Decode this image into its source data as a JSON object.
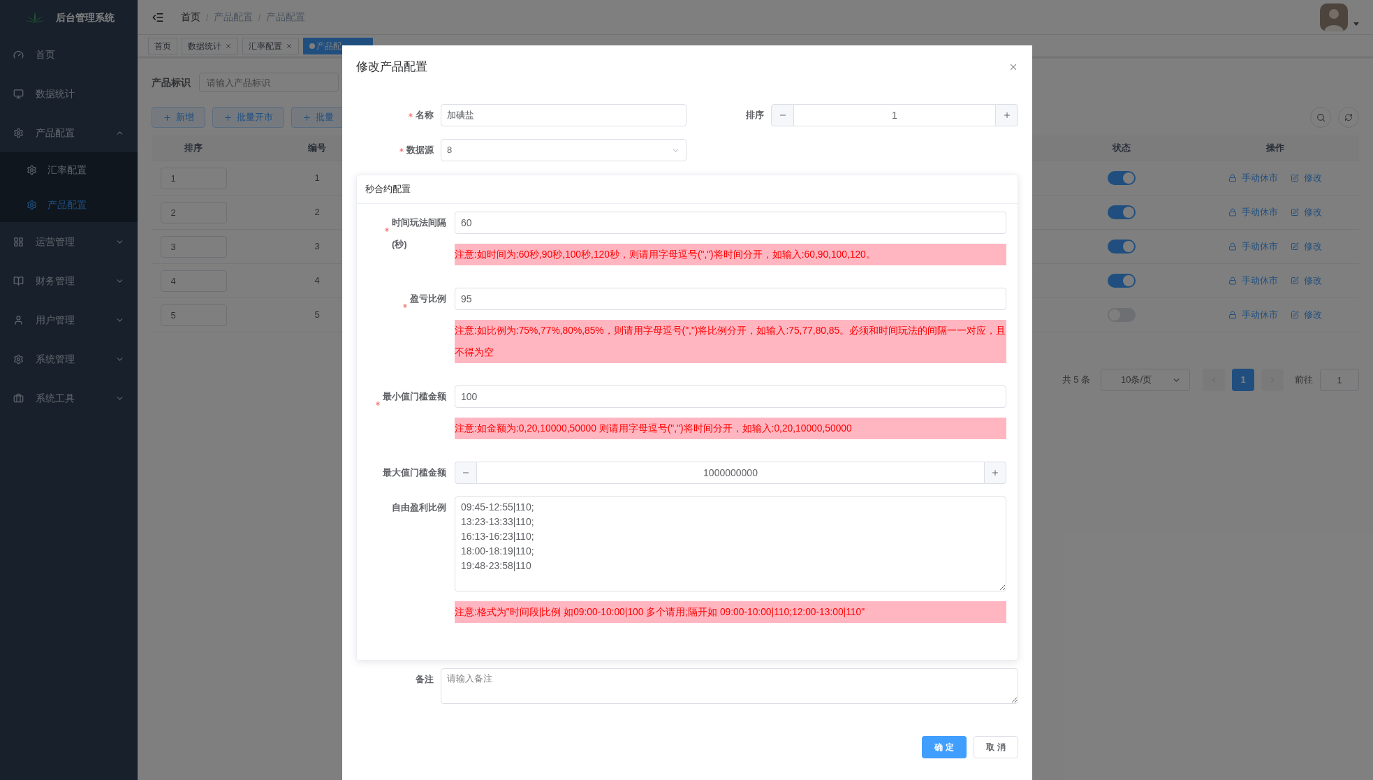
{
  "sidebar": {
    "title": "后台管理系统",
    "items": [
      {
        "label": "首页"
      },
      {
        "label": "数据统计"
      },
      {
        "label": "产品配置",
        "expanded": true,
        "children": [
          {
            "label": "汇率配置",
            "selected": false
          },
          {
            "label": "产品配置",
            "selected": true
          }
        ]
      },
      {
        "label": "运营管理",
        "expanded": false
      },
      {
        "label": "财务管理",
        "expanded": false
      },
      {
        "label": "用户管理",
        "expanded": false
      },
      {
        "label": "系统管理",
        "expanded": false
      },
      {
        "label": "系统工具",
        "expanded": false
      }
    ]
  },
  "breadcrumb": [
    "首页",
    "产品配置",
    "产品配置"
  ],
  "tabs": [
    {
      "label": "首页",
      "selected": false,
      "closable": false
    },
    {
      "label": "数据统计",
      "selected": false,
      "closable": true
    },
    {
      "label": "汇率配置",
      "selected": false,
      "closable": true
    },
    {
      "label": "产品配",
      "selected": true,
      "closable": false
    }
  ],
  "filter": {
    "label": "产品标识",
    "placeholder": "请输入产品标识"
  },
  "toolbar": [
    "新增",
    "批量开市",
    "批量"
  ],
  "table": {
    "columns": [
      "排序",
      "编号",
      "状态",
      "操作"
    ],
    "rows": [
      {
        "sort": "1",
        "number": "1",
        "on": true,
        "actions": [
          "手动休市",
          "修改"
        ]
      },
      {
        "sort": "2",
        "number": "2",
        "on": true,
        "actions": [
          "手动休市",
          "修改"
        ]
      },
      {
        "sort": "3",
        "number": "3",
        "on": true,
        "actions": [
          "手动休市",
          "修改"
        ]
      },
      {
        "sort": "4",
        "number": "4",
        "on": true,
        "actions": [
          "手动休市",
          "修改"
        ]
      },
      {
        "sort": "5",
        "number": "5",
        "on": false,
        "actions": [
          "手动休市",
          "修改"
        ]
      }
    ]
  },
  "pagination": {
    "total": "共 5 条",
    "page_size": "10条/页",
    "pages": [
      {
        "label": "1",
        "selected": true
      }
    ],
    "goto_label": "前往",
    "goto_value": "1"
  },
  "dialog": {
    "title": "修改产品配置",
    "name": {
      "label": "名称",
      "required": true,
      "value": "加碘盐"
    },
    "sort": {
      "label": "排序",
      "value": "1"
    },
    "source": {
      "label": "数据源",
      "required": true,
      "value": "8"
    },
    "section": {
      "title": "秒合约配置",
      "fields": [
        {
          "kind": "text",
          "label": "时间玩法间隔\n(秒)",
          "required": true,
          "value": "60",
          "note": "注意:如时间为:60秒,90秒,100秒,120秒，则请用字母逗号(\",\")将时间分开，如输入:60,90,100,120。"
        },
        {
          "kind": "text",
          "label": "盈亏比例",
          "required": true,
          "value": "95",
          "note": "注意:如比例为:75%,77%,80%,85%，则请用字母逗号(\",\")将比例分开，如输入:75,77,80,85。必须和时间玩法的间隔一一对应，且不得为空"
        },
        {
          "kind": "text",
          "label": "最小值门槛金额",
          "required": true,
          "value": "100",
          "note": "注意:如金额为:0,20,10000,50000 则请用字母逗号(\",\")将时间分开，如输入:0,20,10000,50000"
        },
        {
          "kind": "stepper",
          "label": "最大值门槛金额",
          "required": false,
          "value": "1000000000"
        },
        {
          "kind": "textarea",
          "label": "自由盈利比例",
          "required": false,
          "value": "09:45-12:55|110;\n13:23-13:33|110;\n16:13-16:23|110;\n18:00-18:19|110;\n19:48-23:58|110",
          "note": "注意:格式为\"时间段|比例 如09:00-10:00|100 多个请用;隔开如 09:00-10:00|110;12:00-13:00|110\""
        }
      ]
    },
    "remark": {
      "label": "备注",
      "placeholder": "请输入备注"
    },
    "buttons": [
      {
        "label": "确 定",
        "kind": "primary"
      },
      {
        "label": "取 消",
        "kind": "default"
      }
    ]
  }
}
